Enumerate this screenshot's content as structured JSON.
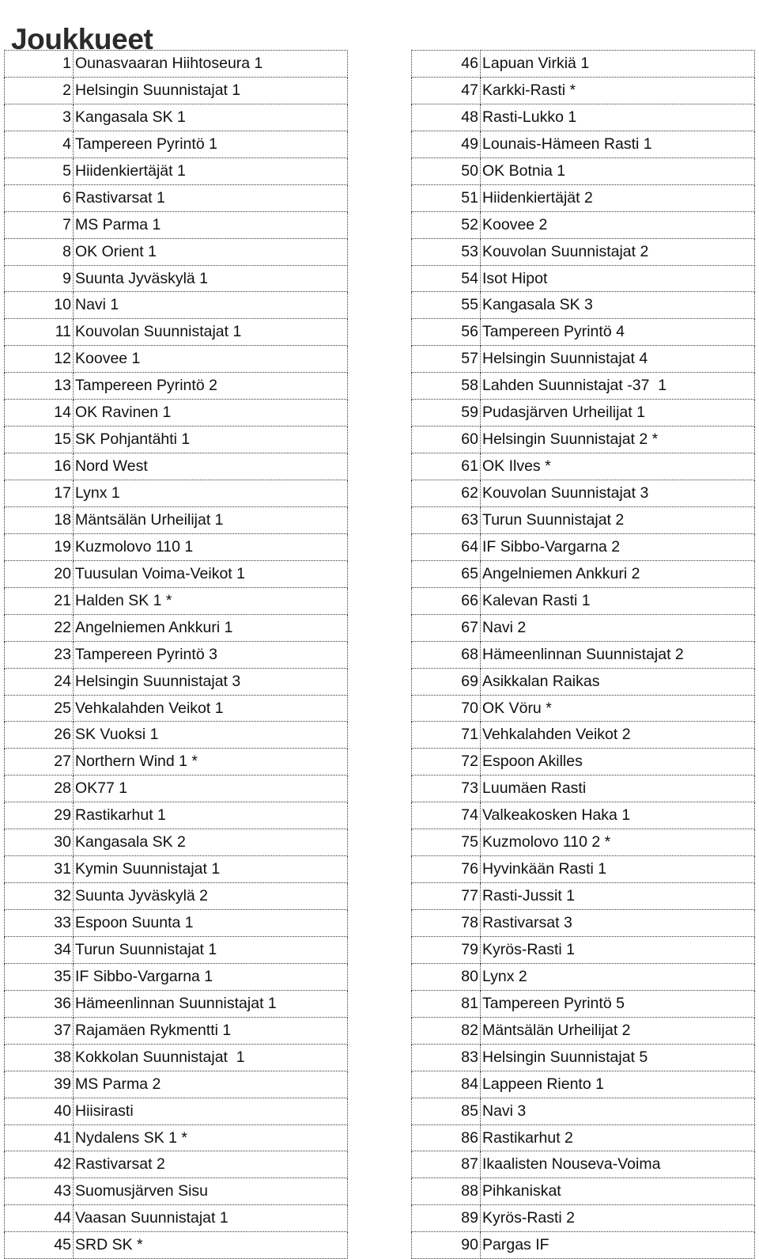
{
  "page": {
    "title": "Joukkueet"
  },
  "tables": {
    "left": {
      "name": "teams-list-left",
      "rows": [
        {
          "num": "1",
          "team": "Ounasvaaran Hiihtoseura 1"
        },
        {
          "num": "2",
          "team": "Helsingin Suunnistajat 1"
        },
        {
          "num": "3",
          "team": "Kangasala SK 1"
        },
        {
          "num": "4",
          "team": "Tampereen Pyrintö 1"
        },
        {
          "num": "5",
          "team": "Hiidenkiertäjät 1"
        },
        {
          "num": "6",
          "team": "Rastivarsat 1"
        },
        {
          "num": "7",
          "team": "MS Parma 1"
        },
        {
          "num": "8",
          "team": "OK Orient 1"
        },
        {
          "num": "9",
          "team": "Suunta Jyväskylä 1"
        },
        {
          "num": "10",
          "team": "Navi 1"
        },
        {
          "num": "11",
          "team": "Kouvolan Suunnistajat 1"
        },
        {
          "num": "12",
          "team": "Koovee 1"
        },
        {
          "num": "13",
          "team": "Tampereen Pyrintö 2"
        },
        {
          "num": "14",
          "team": "OK Ravinen 1"
        },
        {
          "num": "15",
          "team": "SK Pohjantähti 1"
        },
        {
          "num": "16",
          "team": "Nord West"
        },
        {
          "num": "17",
          "team": "Lynx 1"
        },
        {
          "num": "18",
          "team": "Mäntsälän Urheilijat 1"
        },
        {
          "num": "19",
          "team": "Kuzmolovo 110 1"
        },
        {
          "num": "20",
          "team": "Tuusulan Voima-Veikot 1"
        },
        {
          "num": "21",
          "team": "Halden SK 1 *"
        },
        {
          "num": "22",
          "team": "Angelniemen Ankkuri 1"
        },
        {
          "num": "23",
          "team": "Tampereen Pyrintö 3"
        },
        {
          "num": "24",
          "team": "Helsingin Suunnistajat 3"
        },
        {
          "num": "25",
          "team": "Vehkalahden Veikot 1"
        },
        {
          "num": "26",
          "team": "SK Vuoksi 1"
        },
        {
          "num": "27",
          "team": "Northern Wind 1 *"
        },
        {
          "num": "28",
          "team": "OK77 1"
        },
        {
          "num": "29",
          "team": "Rastikarhut 1"
        },
        {
          "num": "30",
          "team": "Kangasala SK 2"
        },
        {
          "num": "31",
          "team": "Kymin Suunnistajat 1"
        },
        {
          "num": "32",
          "team": "Suunta Jyväskylä 2"
        },
        {
          "num": "33",
          "team": "Espoon Suunta 1"
        },
        {
          "num": "34",
          "team": "Turun Suunnistajat 1"
        },
        {
          "num": "35",
          "team": "IF Sibbo-Vargarna 1"
        },
        {
          "num": "36",
          "team": "Hämeenlinnan Suunnistajat 1"
        },
        {
          "num": "37",
          "team": "Rajamäen Rykmentti 1"
        },
        {
          "num": "38",
          "team": "Kokkolan Suunnistajat  1"
        },
        {
          "num": "39",
          "team": "MS Parma 2"
        },
        {
          "num": "40",
          "team": "Hiisirasti"
        },
        {
          "num": "41",
          "team": "Nydalens SK 1 *"
        },
        {
          "num": "42",
          "team": "Rastivarsat 2"
        },
        {
          "num": "43",
          "team": "Suomusjärven Sisu"
        },
        {
          "num": "44",
          "team": "Vaasan Suunnistajat 1"
        },
        {
          "num": "45",
          "team": "SRD SK *"
        }
      ]
    },
    "right": {
      "name": "teams-list-right",
      "rows": [
        {
          "num": "46",
          "team": "Lapuan Virkiä 1"
        },
        {
          "num": "47",
          "team": "Karkki-Rasti *"
        },
        {
          "num": "48",
          "team": "Rasti-Lukko 1"
        },
        {
          "num": "49",
          "team": "Lounais-Hämeen Rasti 1"
        },
        {
          "num": "50",
          "team": "OK Botnia 1"
        },
        {
          "num": "51",
          "team": "Hiidenkiertäjät 2"
        },
        {
          "num": "52",
          "team": "Koovee 2"
        },
        {
          "num": "53",
          "team": "Kouvolan Suunnistajat 2"
        },
        {
          "num": "54",
          "team": "Isot Hipot"
        },
        {
          "num": "55",
          "team": "Kangasala SK 3"
        },
        {
          "num": "56",
          "team": "Tampereen Pyrintö 4"
        },
        {
          "num": "57",
          "team": "Helsingin Suunnistajat 4"
        },
        {
          "num": "58",
          "team": "Lahden Suunnistajat -37  1"
        },
        {
          "num": "59",
          "team": "Pudasjärven Urheilijat 1"
        },
        {
          "num": "60",
          "team": "Helsingin Suunnistajat 2 *"
        },
        {
          "num": "61",
          "team": "OK Ilves *"
        },
        {
          "num": "62",
          "team": "Kouvolan Suunnistajat 3"
        },
        {
          "num": "63",
          "team": "Turun Suunnistajat 2"
        },
        {
          "num": "64",
          "team": "IF Sibbo-Vargarna 2"
        },
        {
          "num": "65",
          "team": "Angelniemen Ankkuri 2"
        },
        {
          "num": "66",
          "team": "Kalevan Rasti 1"
        },
        {
          "num": "67",
          "team": "Navi 2"
        },
        {
          "num": "68",
          "team": "Hämeenlinnan Suunnistajat 2"
        },
        {
          "num": "69",
          "team": "Asikkalan Raikas"
        },
        {
          "num": "70",
          "team": "OK Vöru *"
        },
        {
          "num": "71",
          "team": "Vehkalahden Veikot 2"
        },
        {
          "num": "72",
          "team": "Espoon Akilles"
        },
        {
          "num": "73",
          "team": "Luumäen Rasti"
        },
        {
          "num": "74",
          "team": "Valkeakosken Haka 1"
        },
        {
          "num": "75",
          "team": "Kuzmolovo 110 2 *"
        },
        {
          "num": "76",
          "team": "Hyvinkään Rasti 1"
        },
        {
          "num": "77",
          "team": "Rasti-Jussit 1"
        },
        {
          "num": "78",
          "team": "Rastivarsat 3"
        },
        {
          "num": "79",
          "team": "Kyrös-Rasti 1"
        },
        {
          "num": "80",
          "team": "Lynx 2"
        },
        {
          "num": "81",
          "team": "Tampereen Pyrintö 5"
        },
        {
          "num": "82",
          "team": "Mäntsälän Urheilijat 2"
        },
        {
          "num": "83",
          "team": "Helsingin Suunnistajat 5"
        },
        {
          "num": "84",
          "team": "Lappeen Riento 1"
        },
        {
          "num": "85",
          "team": "Navi 3"
        },
        {
          "num": "86",
          "team": "Rastikarhut 2"
        },
        {
          "num": "87",
          "team": "Ikaalisten Nouseva-Voima"
        },
        {
          "num": "88",
          "team": "Pihkaniskat"
        },
        {
          "num": "89",
          "team": "Kyrös-Rasti 2"
        },
        {
          "num": "90",
          "team": "Pargas IF"
        }
      ]
    }
  }
}
